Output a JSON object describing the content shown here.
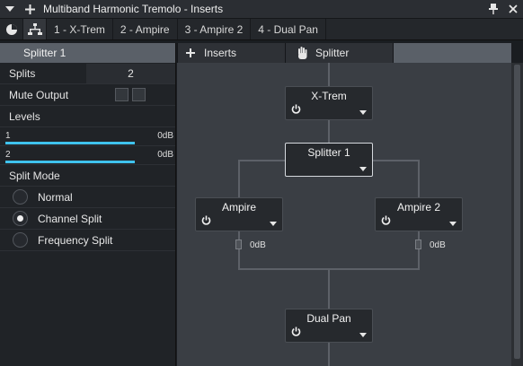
{
  "window": {
    "title": "Multiband Harmonic Tremolo - Inserts"
  },
  "tabs": [
    {
      "label": "1 - X-Trem"
    },
    {
      "label": "2 - Ampire"
    },
    {
      "label": "3 - Ampire 2"
    },
    {
      "label": "4 - Dual Pan"
    }
  ],
  "panel": {
    "header": "Splitter 1",
    "splits_label": "Splits",
    "splits_value": "2",
    "mute_label": "Mute Output",
    "levels_label": "Levels",
    "levels": [
      {
        "num": "1",
        "db": "0dB"
      },
      {
        "num": "2",
        "db": "0dB"
      }
    ],
    "split_mode_label": "Split Mode",
    "modes": [
      {
        "label": "Normal",
        "selected": false
      },
      {
        "label": "Channel Split",
        "selected": true
      },
      {
        "label": "Frequency Split",
        "selected": false
      }
    ]
  },
  "headers": {
    "inserts": "Inserts",
    "splitter": "Splitter"
  },
  "graph": {
    "nodes": {
      "xtrem": "X-Trem",
      "splitter": "Splitter 1",
      "ampire": "Ampire",
      "ampire2": "Ampire 2",
      "dualpan": "Dual Pan"
    },
    "fader_left": "0dB",
    "fader_right": "0dB"
  },
  "colors": {
    "accent": "#3fc3ee",
    "panel_header": "#5a6068",
    "routing_bg": "#3a3e44"
  }
}
